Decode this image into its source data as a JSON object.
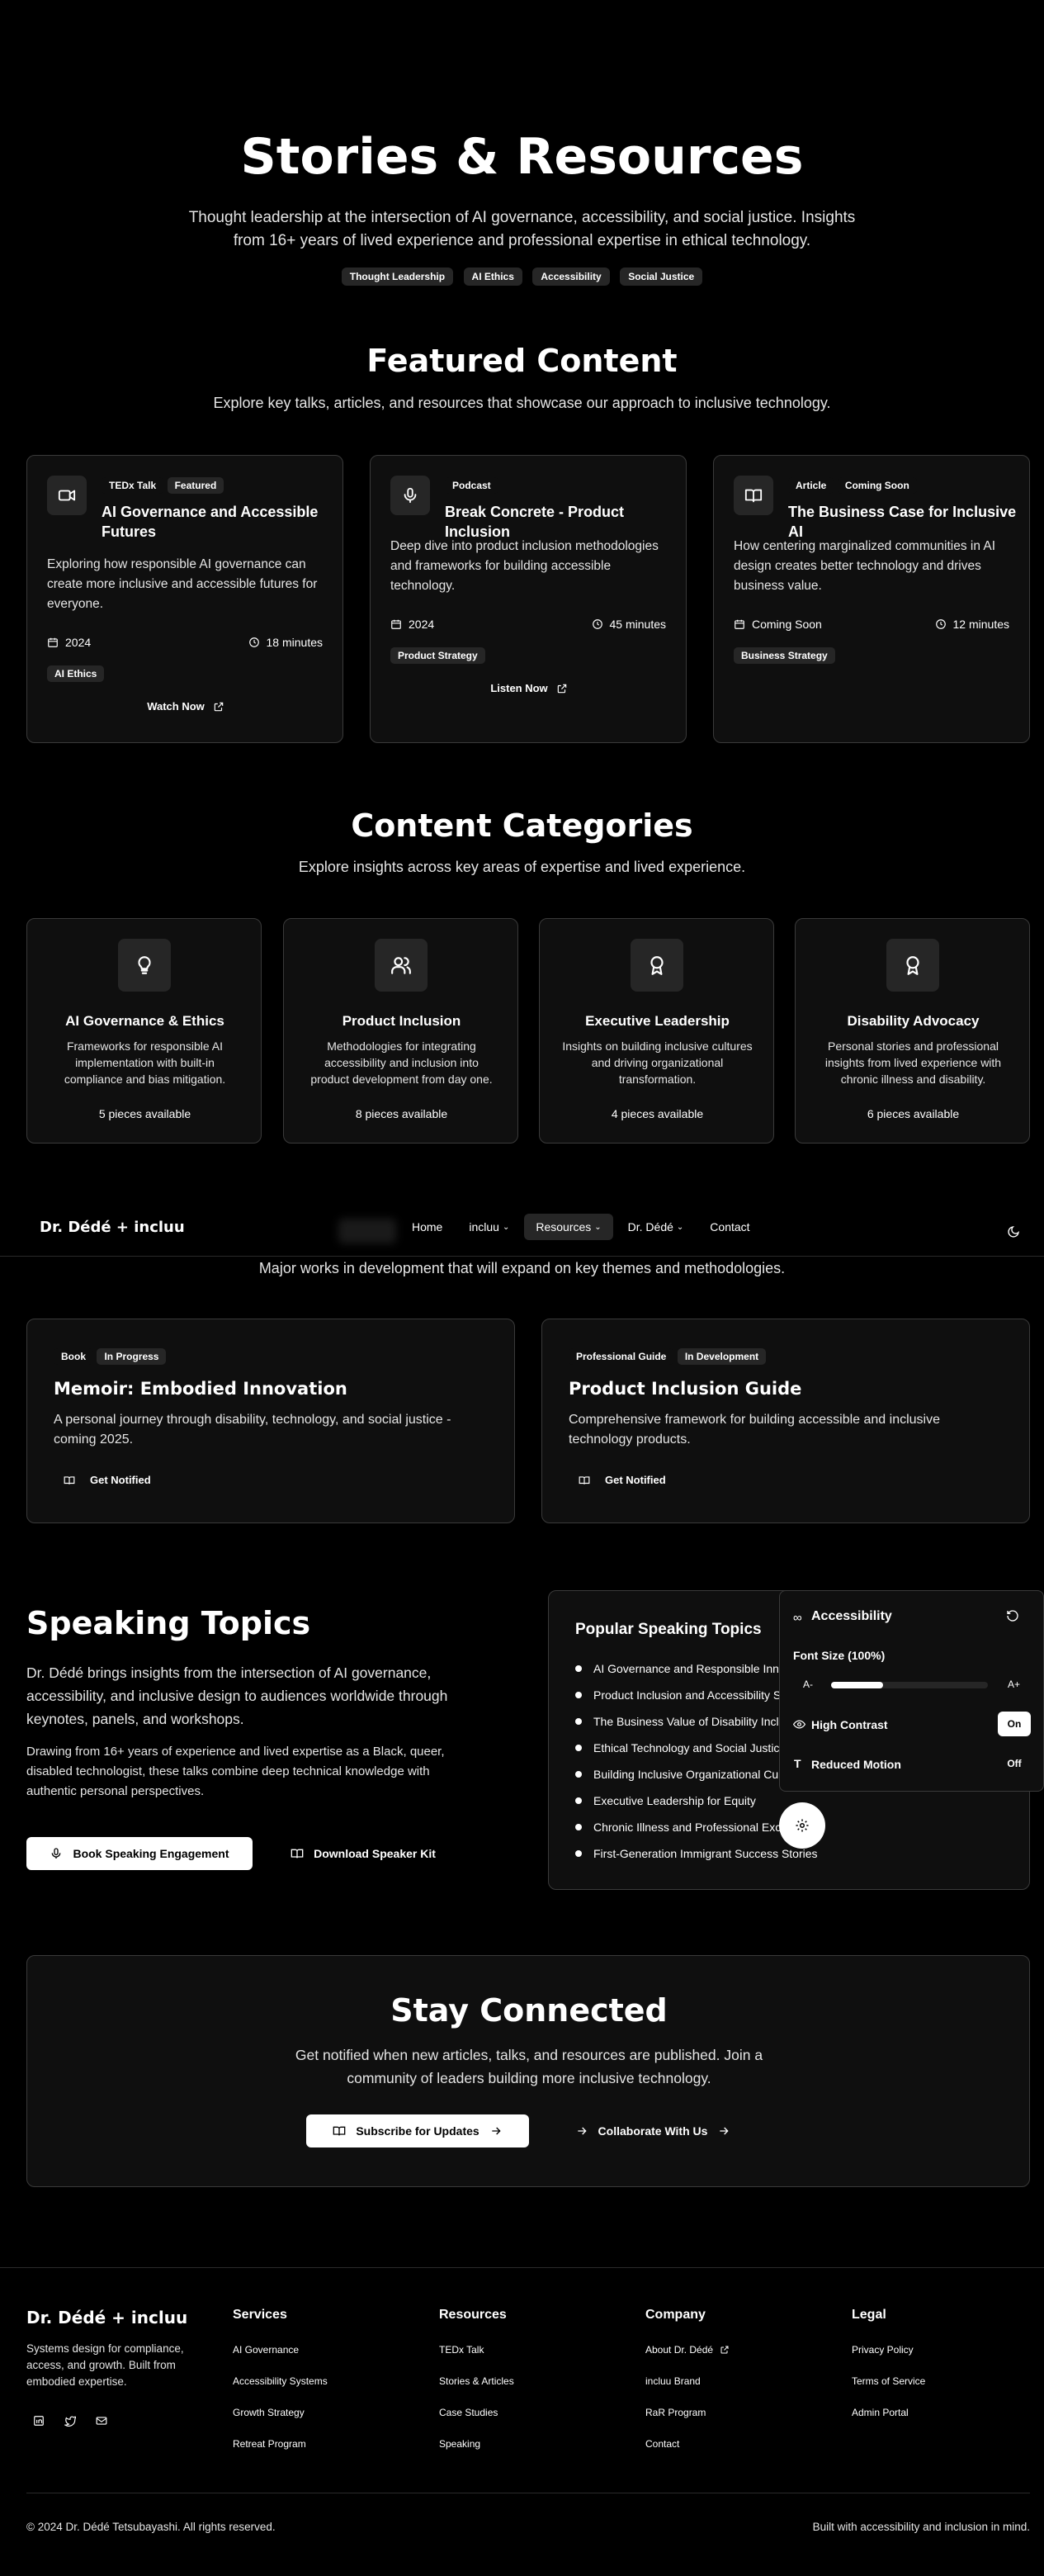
{
  "hero": {
    "title": "Stories & Resources",
    "subtitle_line1": "Thought leadership at the intersection of AI governance, accessibility, and social justice. Insights",
    "subtitle_line2": "from 16+ years of lived experience and professional expertise in ethical technology.",
    "tags": [
      "Thought Leadership",
      "AI Ethics",
      "Accessibility",
      "Social Justice"
    ]
  },
  "featured": {
    "title": "Featured Content",
    "subtitle": "Explore key talks, articles, and resources that showcase our approach to inclusive technology.",
    "cards": [
      {
        "icon": "video-icon",
        "type": "TEDx Talk",
        "badge": "Featured",
        "title": "AI Governance and Accessible Futures",
        "desc": "Exploring how responsible AI governance can create more inclusive and accessible futures for everyone.",
        "date": "2024",
        "duration": "18 minutes",
        "tag": "AI Ethics",
        "action": "Watch Now"
      },
      {
        "icon": "microphone-icon",
        "type": "Podcast",
        "badge": "",
        "title": "Break Concrete - Product Inclusion",
        "desc": "Deep dive into product inclusion methodologies and frameworks for building accessible technology.",
        "date": "2024",
        "duration": "45 minutes",
        "tag": "Product Strategy",
        "action": "Listen Now"
      },
      {
        "icon": "book-icon",
        "type": "Article",
        "badge": "Coming Soon",
        "title": "The Business Case for Inclusive AI",
        "desc": "How centering marginalized communities in AI design creates better technology and drives business value.",
        "date": "Coming Soon",
        "duration": "12 minutes",
        "tag": "Business Strategy",
        "action": ""
      }
    ]
  },
  "categories": {
    "title": "Content Categories",
    "subtitle": "Explore insights across key areas of expertise and lived experience.",
    "items": [
      {
        "icon": "lightbulb-icon",
        "title": "AI Governance & Ethics",
        "desc": "Frameworks for responsible AI implementation with built-in compliance and bias mitigation.",
        "count": "5 pieces available"
      },
      {
        "icon": "users-icon",
        "title": "Product Inclusion",
        "desc": "Methodologies for integrating accessibility and inclusion into product development from day one.",
        "count": "8 pieces available"
      },
      {
        "icon": "award-icon",
        "title": "Executive Leadership",
        "desc": "Insights on building inclusive cultures and driving organizational transformation.",
        "count": "4 pieces available"
      },
      {
        "icon": "award-icon",
        "title": "Disability Advocacy",
        "desc": "Personal stories and professional insights from lived experience with chronic illness and disability.",
        "count": "6 pieces available"
      }
    ]
  },
  "nav": {
    "brand": "Dr. Dédé + incluu",
    "items": [
      "Home",
      "incluu",
      "Resources",
      "Dr. Dédé",
      "Contact"
    ]
  },
  "upcoming": {
    "subtitle": "Major works in development that will expand on key themes and methodologies.",
    "cards": [
      {
        "type": "Book",
        "status": "In Progress",
        "title": "Memoir: Embodied Innovation",
        "desc": "A personal journey through disability, technology, and social justice - coming 2025.",
        "action": "Get Notified"
      },
      {
        "type": "Professional Guide",
        "status": "In Development",
        "title": "Product Inclusion Guide",
        "desc": "Comprehensive framework for building accessible and inclusive technology products.",
        "action": "Get Notified"
      }
    ]
  },
  "speaking": {
    "title": "Speaking Topics",
    "intro": "Dr. Dédé brings insights from the intersection of AI governance, accessibility, and inclusive design to audiences worldwide through keynotes, panels, and workshops.",
    "body": "Drawing from 16+ years of experience and lived expertise as a Black, queer, disabled technologist, these talks combine deep technical knowledge with authentic personal perspectives.",
    "book_btn": "Book Speaking Engagement",
    "kit_btn": "Download Speaker Kit",
    "popular_title": "Popular Speaking Topics",
    "topics": [
      "AI Governance and Responsible Inno",
      "Product Inclusion and Accessibility S",
      "The Business Value of Disability Inclu",
      "Ethical Technology and Social Justic",
      "Building Inclusive Organizational Cult",
      "Executive Leadership for Equity",
      "Chronic Illness and Professional Exc",
      "First-Generation Immigrant Success Stories"
    ]
  },
  "accessibility_panel": {
    "title": "Accessibility",
    "font_size_label": "Font Size (100%)",
    "font_size_fraction": 0.33,
    "decrease": "A-",
    "increase": "A+",
    "high_contrast_label": "High Contrast",
    "high_contrast_value": "On",
    "reduced_motion_label": "Reduced Motion",
    "reduced_motion_value": "Off"
  },
  "connect": {
    "title": "Stay Connected",
    "desc_line1": "Get notified when new articles, talks, and resources are published. Join a",
    "desc_line2": "community of leaders building more inclusive technology.",
    "subscribe": "Subscribe for Updates",
    "collaborate": "Collaborate With Us"
  },
  "footer": {
    "brand": "Dr. Dédé + incluu",
    "tagline": "Systems design for compliance, access, and growth. Built from embodied expertise.",
    "columns": [
      {
        "title": "Services",
        "links": [
          "AI Governance",
          "Accessibility Systems",
          "Growth Strategy",
          "Retreat Program"
        ]
      },
      {
        "title": "Resources",
        "links": [
          "TEDx Talk",
          "Stories & Articles",
          "Case Studies",
          "Speaking"
        ]
      },
      {
        "title": "Company",
        "links": [
          "About Dr. Dédé",
          "incluu Brand",
          "RaR Program",
          "Contact"
        ]
      },
      {
        "title": "Legal",
        "links": [
          "Privacy Policy",
          "Terms of Service",
          "Admin Portal"
        ]
      }
    ],
    "copyright": "© 2024 Dr. Dédé Tetsubayashi. All rights reserved.",
    "built": "Built with accessibility and inclusion in mind."
  }
}
